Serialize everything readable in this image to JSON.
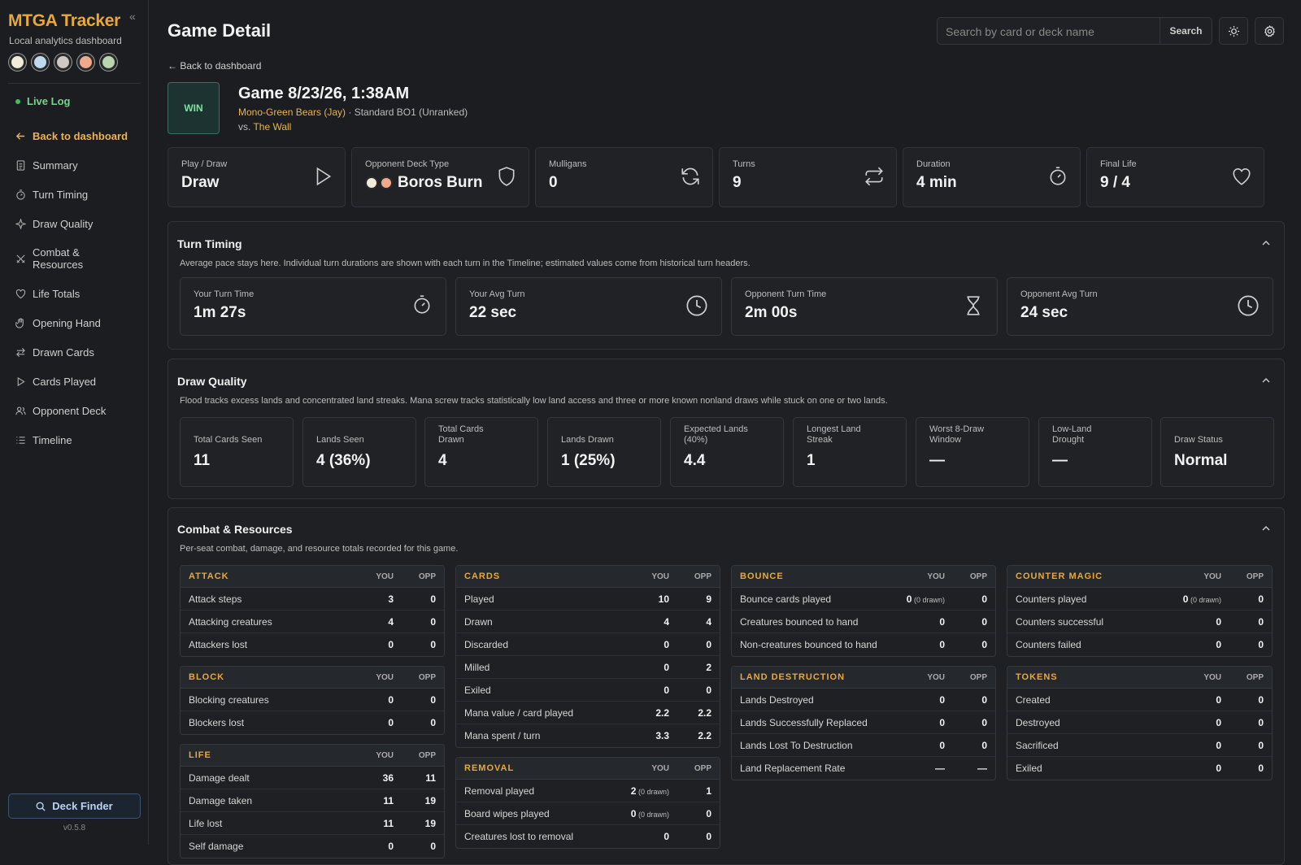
{
  "app": {
    "name": "MTGA Tracker",
    "subtitle": "Local analytics dashboard",
    "version": "v0.5.8",
    "collapse": "«"
  },
  "sidebar": {
    "live": "Live Log",
    "items": [
      {
        "label": "Back to dashboard",
        "icon": "arrow-left-icon"
      },
      {
        "label": "Summary",
        "icon": "document-icon"
      },
      {
        "label": "Turn Timing",
        "icon": "stopwatch-icon"
      },
      {
        "label": "Draw Quality",
        "icon": "sparkle-icon"
      },
      {
        "label": "Combat & Resources",
        "icon": "swords-icon"
      },
      {
        "label": "Life Totals",
        "icon": "heart-icon"
      },
      {
        "label": "Opening Hand",
        "icon": "hand-icon"
      },
      {
        "label": "Drawn Cards",
        "icon": "arrows-swap-icon"
      },
      {
        "label": "Cards Played",
        "icon": "play-icon"
      },
      {
        "label": "Opponent Deck",
        "icon": "users-icon"
      },
      {
        "label": "Timeline",
        "icon": "list-icon"
      }
    ],
    "deck_finder": "Deck Finder"
  },
  "header": {
    "title": "Game Detail",
    "search_placeholder": "Search by card or deck name",
    "search_button": "Search",
    "back": "← Back to dashboard"
  },
  "game": {
    "result": "WIN",
    "title": "Game 8/23/26, 1:38AM",
    "deck": "Mono-Green Bears (Jay)",
    "format": " · Standard BO1 (Unranked)",
    "vs": "vs. ",
    "opponent": "The Wall"
  },
  "stats": [
    {
      "label": "Play / Draw",
      "value": "Draw",
      "icon": "play-icon"
    },
    {
      "label": "Opponent Deck Type",
      "value": "Boros Burn",
      "icon": "shield-icon"
    },
    {
      "label": "Mulligans",
      "value": "0",
      "icon": "refresh-icon"
    },
    {
      "label": "Turns",
      "value": "9",
      "icon": "repeat-icon"
    },
    {
      "label": "Duration",
      "value": "4 min",
      "icon": "stopwatch-icon"
    },
    {
      "label": "Final Life",
      "value": "9 / 4",
      "icon": "heart-icon"
    }
  ],
  "turn_timing": {
    "title": "Turn Timing",
    "desc": "Average pace stays here. Individual turn durations are shown with each turn in the Timeline; estimated values come from historical turn headers.",
    "cards": [
      {
        "label": "Your Turn Time",
        "value": "1m 27s",
        "icon": "stopwatch-icon"
      },
      {
        "label": "Your Avg Turn",
        "value": "22 sec",
        "icon": "clock-icon"
      },
      {
        "label": "Opponent Turn Time",
        "value": "2m 00s",
        "icon": "hourglass-icon"
      },
      {
        "label": "Opponent Avg Turn",
        "value": "24 sec",
        "icon": "clock-icon"
      }
    ]
  },
  "draw_quality": {
    "title": "Draw Quality",
    "desc": "Flood tracks excess lands and concentrated land streaks. Mana screw tracks statistically low land access and three or more known nonland draws while stuck on one or two lands.",
    "cards": [
      {
        "label": "Total Cards Seen",
        "value": "11"
      },
      {
        "label": "Lands Seen",
        "value": "4 (36%)"
      },
      {
        "label": "Total Cards Drawn",
        "value": "4"
      },
      {
        "label": "Lands Drawn",
        "value": "1 (25%)"
      },
      {
        "label": "Expected Lands (40%)",
        "value": "4.4"
      },
      {
        "label": "Longest Land Streak",
        "value": "1"
      },
      {
        "label": "Worst 8-Draw Window",
        "value": "—"
      },
      {
        "label": "Low-Land Drought",
        "value": "—"
      },
      {
        "label": "Draw Status",
        "value": "Normal"
      }
    ]
  },
  "combat": {
    "title": "Combat & Resources",
    "desc": "Per-seat combat, damage, and resource totals recorded for this game.",
    "you": "YOU",
    "opp": "OPP",
    "tables": {
      "attack": {
        "title": "ATTACK",
        "rows": [
          [
            "Attack steps",
            "3",
            "",
            "0"
          ],
          [
            "Attacking creatures",
            "4",
            "",
            "0"
          ],
          [
            "Attackers lost",
            "0",
            "",
            "0"
          ]
        ]
      },
      "block": {
        "title": "BLOCK",
        "rows": [
          [
            "Blocking creatures",
            "0",
            "",
            "0"
          ],
          [
            "Blockers lost",
            "0",
            "",
            "0"
          ]
        ]
      },
      "life": {
        "title": "LIFE",
        "rows": [
          [
            "Damage dealt",
            "36",
            "",
            "11"
          ],
          [
            "Damage taken",
            "11",
            "",
            "19"
          ],
          [
            "Life lost",
            "11",
            "",
            "19"
          ],
          [
            "Self damage",
            "0",
            "",
            "0"
          ]
        ]
      },
      "cards": {
        "title": "CARDS",
        "rows": [
          [
            "Played",
            "10",
            "",
            "9"
          ],
          [
            "Drawn",
            "4",
            "",
            "4"
          ],
          [
            "Discarded",
            "0",
            "",
            "0"
          ],
          [
            "Milled",
            "0",
            "",
            "2"
          ],
          [
            "Exiled",
            "0",
            "",
            "0"
          ],
          [
            "Mana value / card played",
            "2.2",
            "",
            "2.2"
          ],
          [
            "Mana spent / turn",
            "3.3",
            "",
            "2.2"
          ]
        ]
      },
      "removal": {
        "title": "REMOVAL",
        "rows": [
          [
            "Removal played",
            "2",
            " (0 drawn)",
            "1"
          ],
          [
            "Board wipes played",
            "0",
            " (0 drawn)",
            "0"
          ],
          [
            "Creatures lost to removal",
            "0",
            "",
            "0"
          ]
        ]
      },
      "bounce": {
        "title": "BOUNCE",
        "rows": [
          [
            "Bounce cards played",
            "0",
            " (0 drawn)",
            "0"
          ],
          [
            "Creatures bounced to hand",
            "0",
            "",
            "0"
          ],
          [
            "Non-creatures bounced to hand",
            "0",
            "",
            "0"
          ]
        ]
      },
      "land": {
        "title": "LAND DESTRUCTION",
        "rows": [
          [
            "Lands Destroyed",
            "0",
            "",
            "0"
          ],
          [
            "Lands Successfully Replaced",
            "0",
            "",
            "0"
          ],
          [
            "Lands Lost To Destruction",
            "0",
            "",
            "0"
          ],
          [
            "Land Replacement Rate",
            "—",
            "",
            "—"
          ]
        ]
      },
      "counter": {
        "title": "COUNTER MAGIC",
        "rows": [
          [
            "Counters played",
            "0",
            " (0 drawn)",
            "0"
          ],
          [
            "Counters successful",
            "0",
            "",
            "0"
          ],
          [
            "Counters failed",
            "0",
            "",
            "0"
          ]
        ]
      },
      "tokens": {
        "title": "TOKENS",
        "rows": [
          [
            "Created",
            "0",
            "",
            "0"
          ],
          [
            "Destroyed",
            "0",
            "",
            "0"
          ],
          [
            "Sacrificed",
            "0",
            "",
            "0"
          ],
          [
            "Exiled",
            "0",
            "",
            "0"
          ]
        ]
      }
    }
  },
  "colors": {
    "accent": "#e9a93a",
    "win": "#7fe0a0",
    "live": "#3fbf5c"
  }
}
